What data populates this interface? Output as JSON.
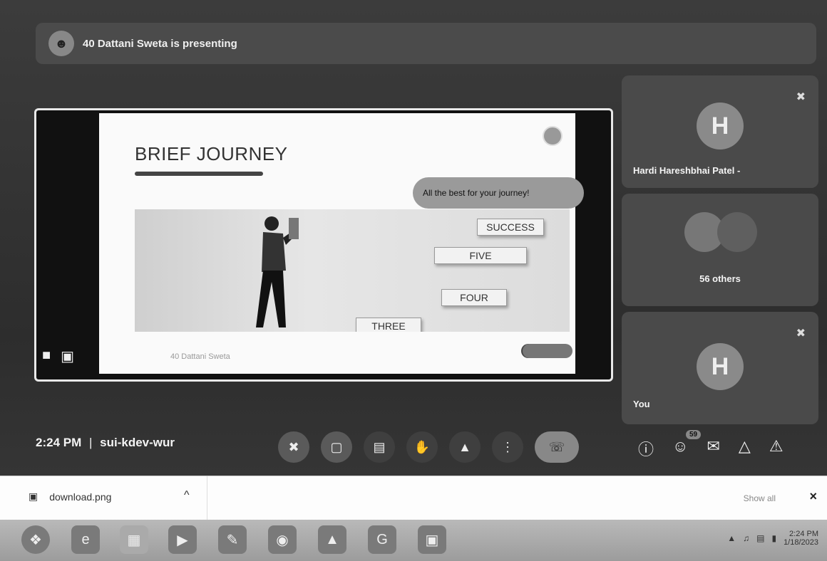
{
  "banner": {
    "text": "40 Dattani Sweta is presenting"
  },
  "slide": {
    "title": "BRIEF JOURNEY",
    "bubble": "All the best for your journey!",
    "steps": [
      "SUCCESS",
      "FIVE",
      "FOUR",
      "THREE"
    ],
    "caption": "40 Dattani Sweta"
  },
  "tiles": [
    {
      "initial": "H",
      "name": "Hardi Hareshbhai Patel -"
    },
    {
      "name": "56 others"
    },
    {
      "initial": "H",
      "name": "You"
    }
  ],
  "bottom": {
    "time": "2:24 PM",
    "separator": "|",
    "meeting_code": "sui-kdev-wur",
    "participant_badge": "59"
  },
  "download": {
    "filename": "download.png",
    "caret": "^",
    "show_all": "Show all",
    "close": "×"
  },
  "taskbar": {
    "time": "2:24 PM",
    "date": "1/18/2023"
  }
}
